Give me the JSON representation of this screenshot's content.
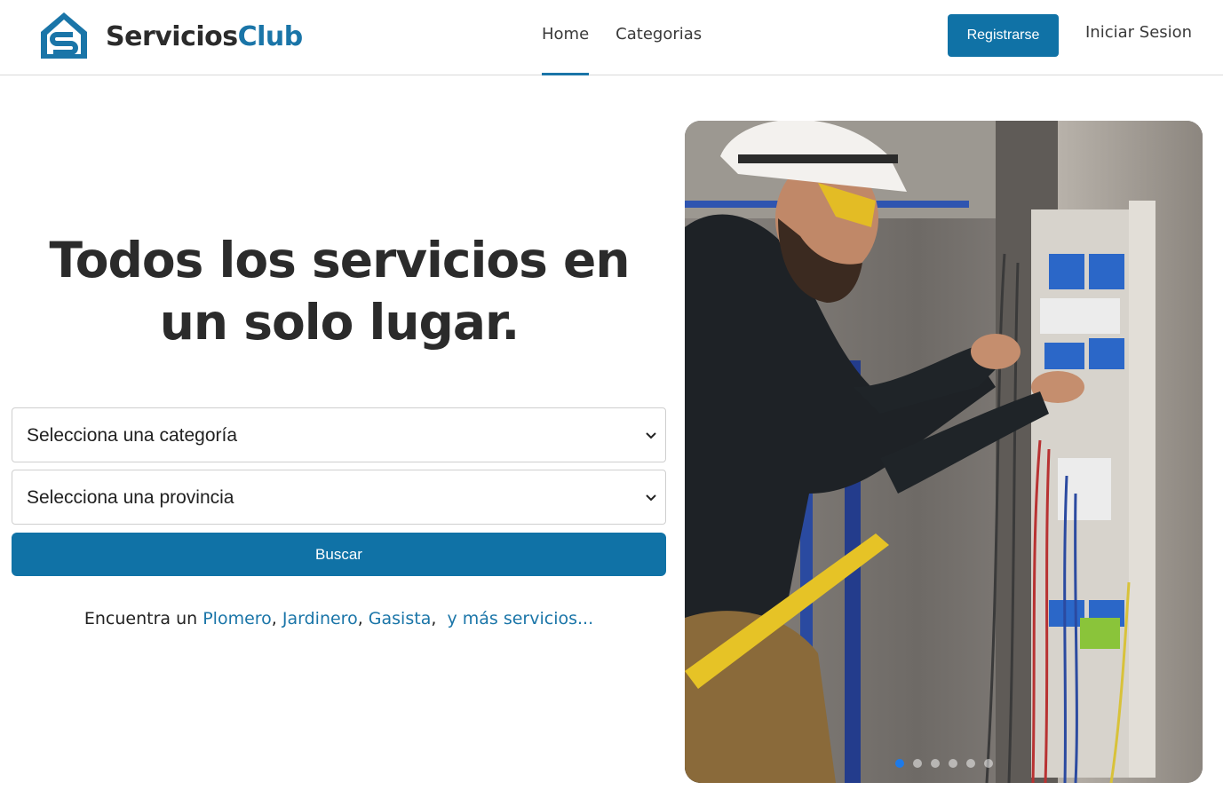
{
  "header": {
    "brand_part1": "Servicios",
    "brand_part2": "Club",
    "logo_icon": "house-s-logo-icon",
    "nav": [
      {
        "label": "Home",
        "active": true
      },
      {
        "label": "Categorias",
        "active": false
      }
    ],
    "register_label": "Registrarse",
    "login_label": "Iniciar Sesion"
  },
  "hero": {
    "title": "Todos los servicios en un solo lugar.",
    "category_select": "Selecciona una categoría",
    "province_select": "Selecciona una provincia",
    "search_label": "Buscar",
    "find_prefix": "Encuentra un",
    "find_links": [
      "Plomero",
      "Jardinero",
      "Gasista"
    ],
    "find_more": "y más servicios..."
  },
  "carousel": {
    "image": "electrician-working-on-panel-photo",
    "slides": 6,
    "active_slide": 1
  },
  "colors": {
    "accent": "#1072a6",
    "brand_blue": "#1a75a8",
    "active_dot": "#1e7ae8"
  }
}
